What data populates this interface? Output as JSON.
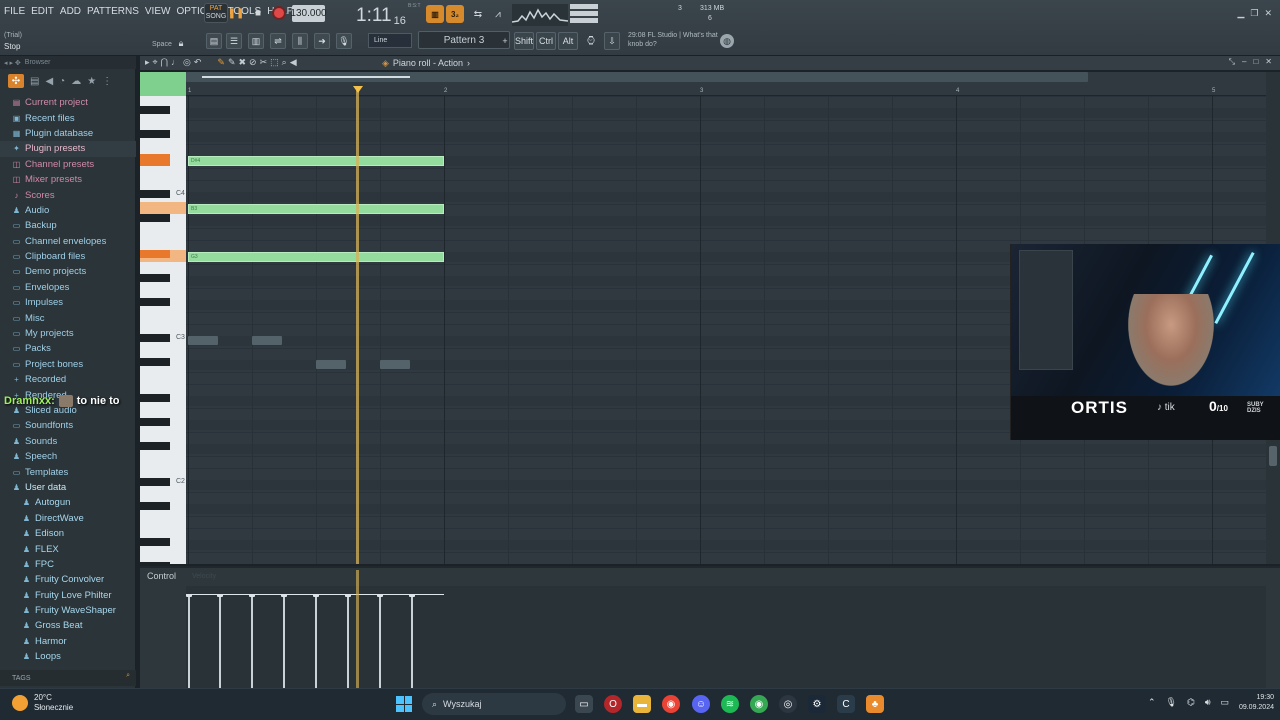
{
  "menu": [
    "FILE",
    "EDIT",
    "ADD",
    "PATTERNS",
    "VIEW",
    "OPTIONS",
    "TOOLS",
    "HELP"
  ],
  "transport": {
    "pat": "PAT",
    "song": "SONG",
    "play": "❚❚",
    "stop": "■",
    "tempo": "130.000",
    "time": "1:11",
    "time_small": "16",
    "bst": "B:S:T"
  },
  "orange_btns": [
    "▥",
    "3₂"
  ],
  "memory": {
    "cpu": "3",
    "mem": "313 MB",
    "poly": "6"
  },
  "status": {
    "trial": "(Trial)",
    "stop": "Stop",
    "space": "Space"
  },
  "toolbar2": {
    "line": "Line",
    "pattern": "Pattern 3",
    "shift": "Shift",
    "ctrl": "Ctrl",
    "alt": "Alt"
  },
  "news": {
    "time": "29:08",
    "text": "FL Studio | What's that knob do?"
  },
  "browser": {
    "title": "Browser",
    "items": [
      {
        "label": "Current project",
        "icon": "▤",
        "style": "pink"
      },
      {
        "label": "Recent files",
        "icon": "▣",
        "style": ""
      },
      {
        "label": "Plugin database",
        "icon": "▦",
        "style": ""
      },
      {
        "label": "Plugin presets",
        "icon": "✦",
        "style": "hl"
      },
      {
        "label": "Channel presets",
        "icon": "◫",
        "style": "pink"
      },
      {
        "label": "Mixer presets",
        "icon": "◫",
        "style": "pink"
      },
      {
        "label": "Scores",
        "icon": "♪",
        "style": "pink"
      },
      {
        "label": "Audio",
        "icon": "♟",
        "style": ""
      },
      {
        "label": "Backup",
        "icon": "▭",
        "style": ""
      },
      {
        "label": "Channel envelopes",
        "icon": "▭",
        "style": ""
      },
      {
        "label": "Clipboard files",
        "icon": "▭",
        "style": ""
      },
      {
        "label": "Demo projects",
        "icon": "▭",
        "style": ""
      },
      {
        "label": "Envelopes",
        "icon": "▭",
        "style": ""
      },
      {
        "label": "Impulses",
        "icon": "▭",
        "style": ""
      },
      {
        "label": "Misc",
        "icon": "▭",
        "style": ""
      },
      {
        "label": "My projects",
        "icon": "▭",
        "style": ""
      },
      {
        "label": "Packs",
        "icon": "▭",
        "style": ""
      },
      {
        "label": "Project bones",
        "icon": "▭",
        "style": ""
      },
      {
        "label": "Recorded",
        "icon": "+",
        "style": ""
      },
      {
        "label": "Rendered",
        "icon": "+",
        "style": ""
      },
      {
        "label": "Sliced audio",
        "icon": "♟",
        "style": ""
      },
      {
        "label": "Soundfonts",
        "icon": "▭",
        "style": ""
      },
      {
        "label": "Sounds",
        "icon": "♟",
        "style": ""
      },
      {
        "label": "Speech",
        "icon": "♟",
        "style": ""
      },
      {
        "label": "Templates",
        "icon": "▭",
        "style": ""
      },
      {
        "label": "User data",
        "icon": "♟",
        "style": "user"
      },
      {
        "label": "Autogun",
        "icon": "♟",
        "style": "sub"
      },
      {
        "label": "DirectWave",
        "icon": "♟",
        "style": "sub"
      },
      {
        "label": "Edison",
        "icon": "♟",
        "style": "sub"
      },
      {
        "label": "FLEX",
        "icon": "♟",
        "style": "sub"
      },
      {
        "label": "FPC",
        "icon": "♟",
        "style": "sub"
      },
      {
        "label": "Fruity Convolver",
        "icon": "♟",
        "style": "sub"
      },
      {
        "label": "Fruity Love Philter",
        "icon": "♟",
        "style": "sub"
      },
      {
        "label": "Fruity WaveShaper",
        "icon": "♟",
        "style": "sub"
      },
      {
        "label": "Gross Beat",
        "icon": "♟",
        "style": "sub"
      },
      {
        "label": "Harmor",
        "icon": "♟",
        "style": "sub"
      },
      {
        "label": "Loops",
        "icon": "♟",
        "style": "sub"
      }
    ],
    "tags": "TAGS"
  },
  "chat": {
    "user": "Dramnxx:",
    "msg": "to nie to"
  },
  "piano_roll": {
    "title": "Piano roll - Action",
    "bars": [
      "1",
      "2",
      "3",
      "4",
      "5"
    ],
    "key_labels": [
      "C4",
      "C3",
      "C2"
    ],
    "notes": [
      {
        "label": "D#4"
      },
      {
        "label": "B3"
      },
      {
        "label": "G3"
      }
    ],
    "control": "Control",
    "control_sub": "Velocity"
  },
  "cam": {
    "name": "ORTIS",
    "tiktok": "♪ tik",
    "count": "0",
    "count_of": "/10",
    "sub_line1": "SUBY",
    "sub_line2": "DZIS"
  },
  "taskbar": {
    "temp": "20°C",
    "weather": "Słonecznie",
    "search": "Wyszukaj",
    "time": "19:30",
    "date": "09.09.2024"
  },
  "colors": {
    "accent": "#e0912f",
    "note": "#93dc9d",
    "playhead": "#d7b155",
    "chat_user": "#9ef05b"
  }
}
